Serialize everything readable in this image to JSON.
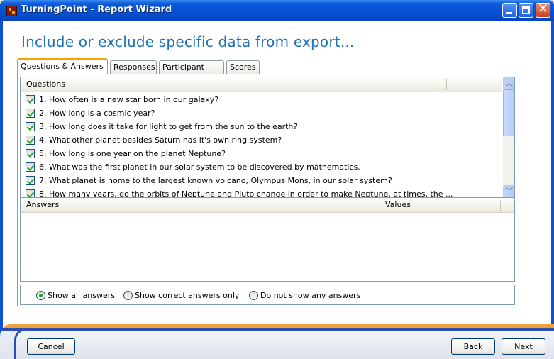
{
  "window": {
    "title": "TurningPoint - Report Wizard"
  },
  "heading": "Include or exclude specific data from export...",
  "tabs": [
    {
      "label": "Questions & Answers",
      "active": true
    },
    {
      "label": "Responses",
      "active": false
    },
    {
      "label": "Participant Info",
      "active": false
    },
    {
      "label": "Scores",
      "active": false
    }
  ],
  "questions": {
    "header": "Questions",
    "rows": [
      {
        "text": "1.  How often is a new star born in our galaxy?",
        "checked": true
      },
      {
        "text": "2.  How long is a cosmic year?",
        "checked": true
      },
      {
        "text": "3.  How long does it take for light to get from the sun to the earth?",
        "checked": true
      },
      {
        "text": "4.  What other planet besides Saturn has it's own ring system?",
        "checked": true
      },
      {
        "text": "5.  How long is one year on the planet Neptune?",
        "checked": true
      },
      {
        "text": "6.  What was the first planet in our solar system to be discovered by mathematics.",
        "checked": true
      },
      {
        "text": "7.  What planet is home to the largest known volcano, Olympus Mons, in our solar system?",
        "checked": true
      },
      {
        "text": "8.  How many years, do the orbits of Neptune and Pluto change in order to make Neptune, at times, the ...",
        "checked": true
      }
    ]
  },
  "answers": {
    "header_answers": "Answers",
    "header_values": "Values"
  },
  "answer_filter": {
    "options": [
      {
        "label": "Show all answers",
        "checked": true
      },
      {
        "label": "Show correct answers only",
        "checked": false
      },
      {
        "label": "Do not show any answers",
        "checked": false
      }
    ]
  },
  "buttons": {
    "cancel": "Cancel",
    "back": "Back",
    "next": "Next"
  },
  "colors": {
    "heading": "#1e72b8",
    "titlebar": "#0553d3",
    "accent": "#f5a300"
  }
}
